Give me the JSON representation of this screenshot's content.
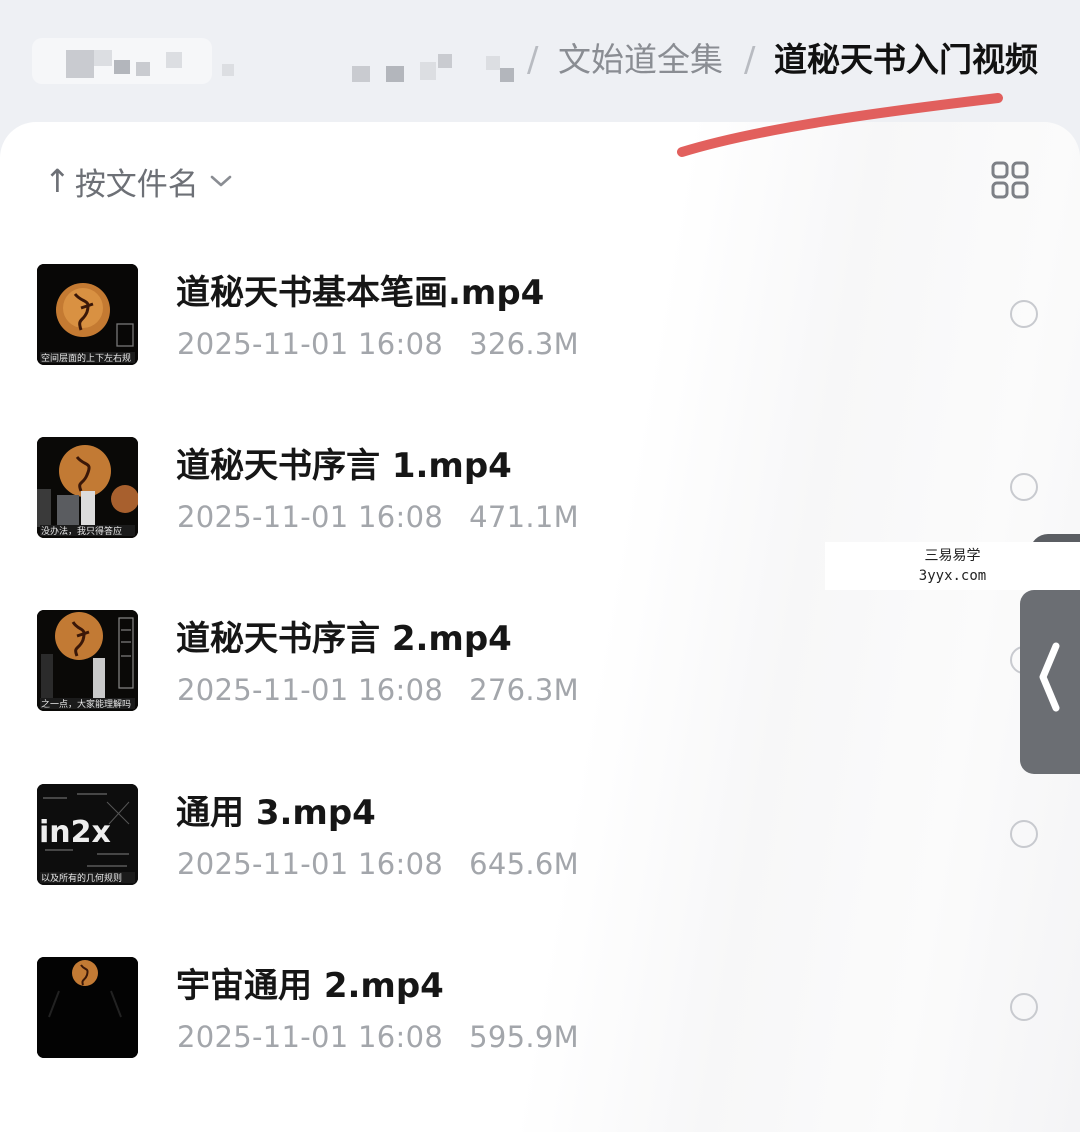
{
  "breadcrumb": {
    "parent": "文始道全集",
    "current": "道秘天书入门视频",
    "separator": "/"
  },
  "toolbar": {
    "sort_arrow": "↑",
    "sort_label": "按文件名",
    "sort_chevron_icon": "chevron-down-icon",
    "view_toggle_icon": "grid-view-icon"
  },
  "files": [
    {
      "name": "道秘天书基本笔画.mp4",
      "date": "2025-11-01 16:08",
      "size": "326.3M",
      "thumb_caption": "空间层面的上下左右规"
    },
    {
      "name": "道秘天书序言 1.mp4",
      "date": "2025-11-01 16:08",
      "size": "471.1M",
      "thumb_caption": "没办法，我只得答应"
    },
    {
      "name": "道秘天书序言 2.mp4",
      "date": "2025-11-01 16:08",
      "size": "276.3M",
      "thumb_caption": "之一点，大家能理解吗"
    },
    {
      "name": "通用 3.mp4",
      "date": "2025-11-01 16:08",
      "size": "645.6M",
      "thumb_caption": "以及所有的几何规则"
    },
    {
      "name": "宇宙通用 2.mp4",
      "date": "2025-11-01 16:08",
      "size": "595.9M",
      "thumb_caption": ""
    }
  ],
  "watermark": {
    "line1": "三易易学",
    "line2": "3yyx.com"
  },
  "colors": {
    "background": "#eef0f4",
    "annotation_stroke": "#e0524f",
    "meta_text": "#a3a6ab"
  }
}
